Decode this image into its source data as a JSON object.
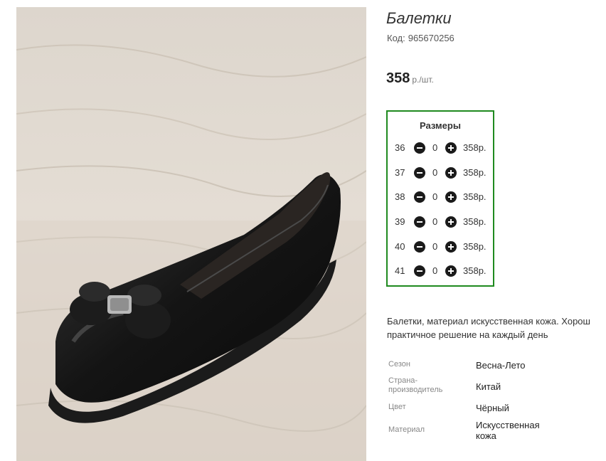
{
  "product": {
    "title": "Балетки",
    "code_label": "Код:",
    "code_value": "965670256",
    "price_value": "358",
    "price_unit": "р./шт.",
    "image_alt": "black-ballet-flat-with-bow"
  },
  "sizes": {
    "title": "Размеры",
    "rows": [
      {
        "size": "36",
        "qty": "0",
        "price": "358р."
      },
      {
        "size": "37",
        "qty": "0",
        "price": "358р."
      },
      {
        "size": "38",
        "qty": "0",
        "price": "358р."
      },
      {
        "size": "39",
        "qty": "0",
        "price": "358р."
      },
      {
        "size": "40",
        "qty": "0",
        "price": "358р."
      },
      {
        "size": "41",
        "qty": "0",
        "price": "358р."
      }
    ]
  },
  "description": {
    "line1": "Балетки, материал искусственная кожа. Хорош",
    "line2": "практичное решение на каждый день"
  },
  "properties": [
    {
      "key": "Сезон",
      "value": "Весна-Лето"
    },
    {
      "key": "Страна-\nпроизводитель",
      "value": "Китай"
    },
    {
      "key": "Цвет",
      "value": "Чёрный"
    },
    {
      "key": "Материал",
      "value": "Искусственная\nкожа"
    }
  ],
  "colors": {
    "accent_border": "#1f8a1f",
    "button": "#1a1a1a"
  }
}
